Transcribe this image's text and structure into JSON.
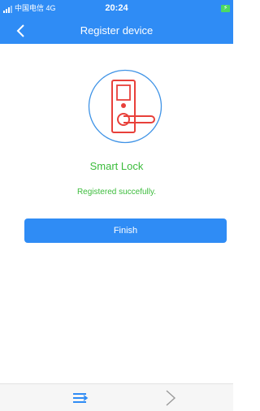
{
  "status_bar": {
    "carrier": "中国电信  4G",
    "time": "20:24",
    "battery_icon": "battery-charging-icon"
  },
  "nav": {
    "title": "Register device",
    "back_icon": "chevron-left-icon"
  },
  "device": {
    "illustration_icon": "smart-lock-icon",
    "name": "Smart Lock",
    "status": "Registered succefully."
  },
  "actions": {
    "finish_label": "Finish"
  },
  "bottom_bar": {
    "menu_icon": "menu-icon",
    "forward_icon": "chevron-right-icon"
  },
  "colors": {
    "primary": "#2f8cf5",
    "success": "#3cbc3c",
    "illustration": "#e8403a"
  }
}
